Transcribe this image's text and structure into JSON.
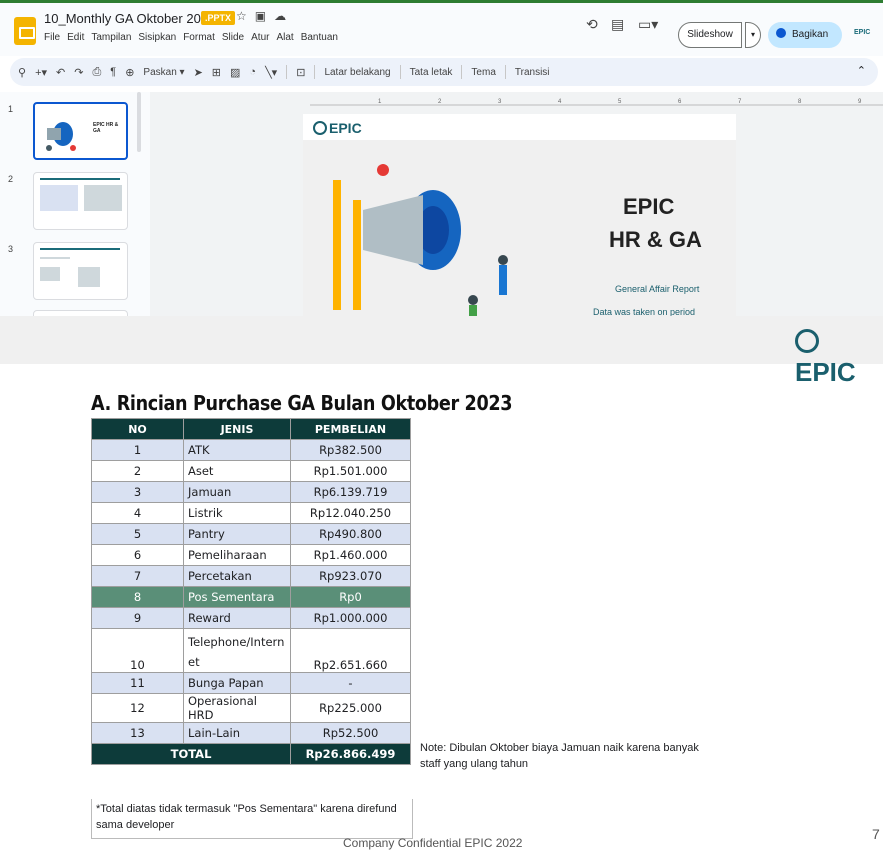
{
  "window": {
    "doc_title": "10_Monthly GA Oktober 2023",
    "file_badge": ".PPTX",
    "slideshow_label": "Slideshow",
    "share_label": "Bagikan",
    "account_logo": "EPIC"
  },
  "menu": [
    "File",
    "Edit",
    "Tampilan",
    "Sisipkan",
    "Format",
    "Slide",
    "Atur",
    "Alat",
    "Bantuan"
  ],
  "toolbar": {
    "zoom": "Paskan ▾",
    "background": "Latar belakang",
    "layout": "Tata letak",
    "theme": "Tema",
    "transition": "Transisi"
  },
  "filmstrip": {
    "0": "1",
    "1": "2",
    "2": "3",
    "thumb1_text": "EPIC HR & GA"
  },
  "slide1": {
    "logo": "EPIC",
    "title1": "EPIC",
    "title2": "HR & GA",
    "subtitle": "General Affair Report",
    "subtitle2": "Data was taken on period"
  },
  "slide7": {
    "logo": "EPIC",
    "heading": "A. Rincian Purchase GA Bulan Oktober 2023",
    "table": {
      "headers": [
        "NO",
        "JENIS",
        "PEMBELIAN"
      ],
      "rows": [
        {
          "no": "1",
          "jenis": "ATK",
          "pembelian": "Rp382.500"
        },
        {
          "no": "2",
          "jenis": "Aset",
          "pembelian": "Rp1.501.000"
        },
        {
          "no": "3",
          "jenis": "Jamuan",
          "pembelian": "Rp6.139.719"
        },
        {
          "no": "4",
          "jenis": "Listrik",
          "pembelian": "Rp12.040.250"
        },
        {
          "no": "5",
          "jenis": "Pantry",
          "pembelian": "Rp490.800"
        },
        {
          "no": "6",
          "jenis": "Pemeliharaan",
          "pembelian": "Rp1.460.000"
        },
        {
          "no": "7",
          "jenis": "Percetakan",
          "pembelian": "Rp923.070"
        },
        {
          "no": "8",
          "jenis": "Pos Sementara",
          "pembelian": "Rp0"
        },
        {
          "no": "9",
          "jenis": "Reward",
          "pembelian": "Rp1.000.000"
        },
        {
          "no": "10",
          "jenis": "Telephone/Internet",
          "pembelian": "Rp2.651.660"
        },
        {
          "no": "11",
          "jenis": "Bunga Papan",
          "pembelian": "-"
        },
        {
          "no": "12",
          "jenis": "Operasional HRD",
          "pembelian": "Rp225.000"
        },
        {
          "no": "13",
          "jenis": "Lain-Lain",
          "pembelian": "Rp52.500"
        }
      ],
      "total_label": "TOTAL",
      "total_value": "Rp26.866.499"
    },
    "footnote": "*Total diatas tidak termasuk \"Pos Sementara\" karena direfund sama developer",
    "note": "Note: Dibulan Oktober biaya Jamuan naik karena banyak staff yang ulang tahun",
    "footer": "Company Confidential EPIC 2022",
    "page_number": "7"
  }
}
